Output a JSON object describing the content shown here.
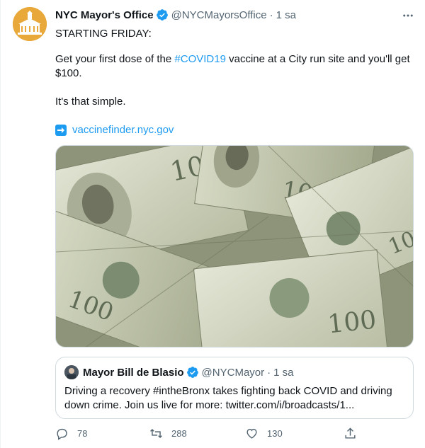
{
  "author": {
    "name": "NYC Mayor's Office",
    "handle": "@NYCMayorsOffice",
    "separator": "·",
    "time": "1 sa",
    "avatar_icon": "city-hall-seal",
    "verified_icon": "verified-badge-icon"
  },
  "tweet": {
    "line1": "STARTING FRIDAY:",
    "line2_before": "Get your first dose of the ",
    "line2_hashtag": "#COVID19",
    "line2_after": " vaccine at a City run site and you'll get $100.",
    "line3": "It's that simple.",
    "link_icon": "right-arrow-emoji",
    "link": "vaccinefinder.nyc.gov",
    "media_description_icon": "money-bills-photo"
  },
  "quote": {
    "name": "Mayor Bill de Blasio",
    "handle": "@NYCMayor",
    "separator": "·",
    "time": "1 sa",
    "text": "Driving a recovery #intheBronx takes fighting back COVID and driving down crime. Join us live for more: twitter.com/i/broadcasts/1..."
  },
  "actions": {
    "reply_count": "78",
    "retweet_count": "288",
    "like_count": "130"
  },
  "colors": {
    "accent": "#1d9bf0",
    "secondary_text": "#536471",
    "avatar_bg": "#e8a83a"
  }
}
